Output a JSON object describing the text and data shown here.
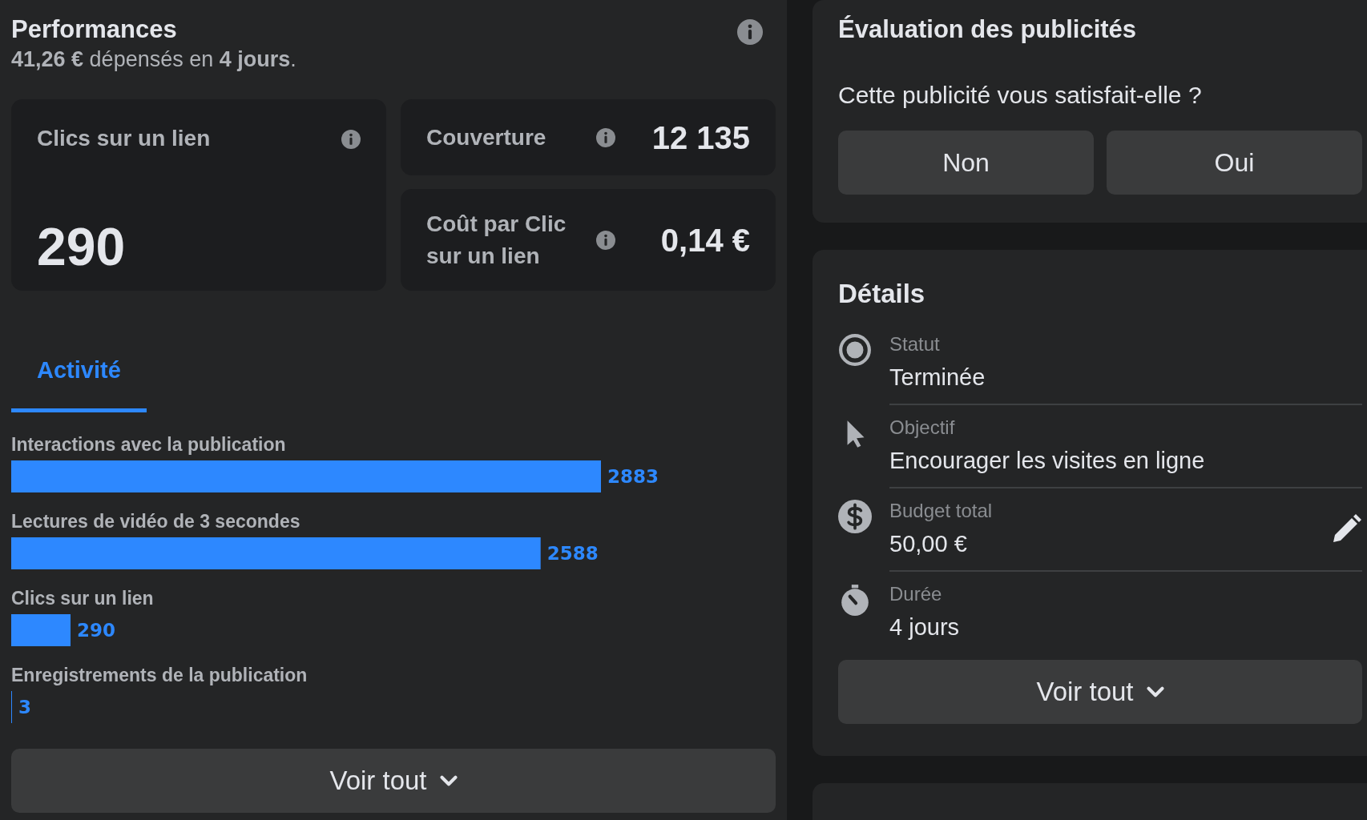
{
  "performance": {
    "title": "Performances",
    "summary": "**41,26 €** dépensés en **4 jours**.",
    "metrics": [
      {
        "kind": "big",
        "label": "Clics sur un lien",
        "value": "290"
      },
      {
        "kind": "row",
        "label": "Couverture",
        "value": "12 135"
      },
      {
        "kind": "row",
        "label": "Coût par Clic sur un lien",
        "value": "0,14 €"
      }
    ],
    "tabs": [
      {
        "label": "Activité",
        "selected": true
      }
    ],
    "activity": {
      "chart_data": {
        "type": "bar",
        "orientation": "horizontal",
        "data_labels": true,
        "categories": [
          "Interactions avec la publication",
          "Lectures de vidéo de 3 secondes",
          "Clics sur un lien",
          "Enregistrements de la publication"
        ],
        "values": [
          2883,
          2588,
          290,
          3
        ]
      }
    },
    "see_all": "Voir tout"
  },
  "rating": {
    "title": "Évaluation des publicités",
    "question": "Cette publicité vous satisfait-elle ?",
    "buttons": [
      "Non",
      "Oui"
    ]
  },
  "details": {
    "title": "Détails",
    "items": [
      {
        "kind": "status",
        "label": "Statut",
        "value": "Terminée",
        "editable": false
      },
      {
        "kind": "objective",
        "label": "Objectif",
        "value": "Encourager les visites en ligne",
        "editable": false
      },
      {
        "kind": "budget",
        "label": "Budget total",
        "value": "50,00 €",
        "editable": true
      },
      {
        "kind": "duration",
        "label": "Durée",
        "value": "4 jours",
        "editable": false
      }
    ],
    "see_all": "Voir tout"
  }
}
